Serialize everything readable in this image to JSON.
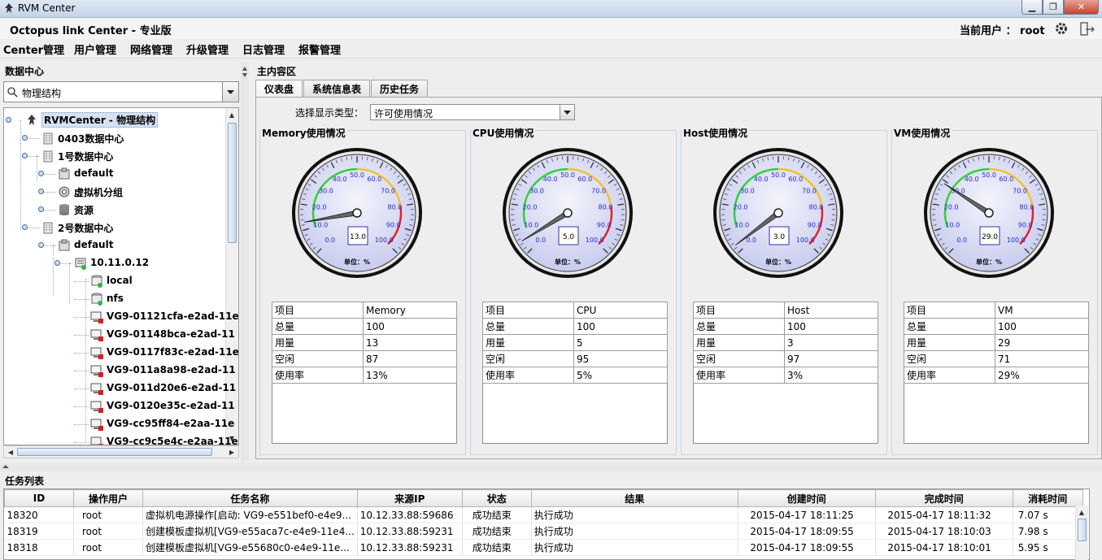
{
  "window": {
    "title": "RVM Center"
  },
  "header": {
    "app_name": "Octopus link Center - 专业版",
    "current_user_label": "当前用户 ： root"
  },
  "menu": [
    "Center管理",
    "用户管理",
    "网络管理",
    "升级管理",
    "日志管理",
    "报警管理"
  ],
  "left": {
    "title": "数据中心",
    "search_value": "物理结构",
    "tree": [
      {
        "label": "RVMCenter - 物理结构",
        "icon": "octopus-icon",
        "level": 0,
        "selected": true
      },
      {
        "label": "0403数据中心",
        "icon": "building-icon",
        "level": 1
      },
      {
        "label": "1号数据中心",
        "icon": "building-icon",
        "level": 1
      },
      {
        "label": "default",
        "icon": "cluster-icon",
        "level": 2
      },
      {
        "label": "虚拟机分组",
        "icon": "vm-group-icon",
        "level": 2
      },
      {
        "label": "资源",
        "icon": "database-icon",
        "level": 2
      },
      {
        "label": "2号数据中心",
        "icon": "building-icon",
        "level": 1
      },
      {
        "label": "default",
        "icon": "cluster-icon",
        "level": 2
      },
      {
        "label": "10.11.0.12",
        "icon": "host-icon",
        "level": 3
      },
      {
        "label": "local",
        "icon": "storage-icon",
        "level": 4
      },
      {
        "label": "nfs",
        "icon": "storage-icon",
        "level": 4
      },
      {
        "label": "VG9-01121cfa-e2ad-11e",
        "icon": "vm-icon",
        "level": 4
      },
      {
        "label": "VG9-01148bca-e2ad-11",
        "icon": "vm-icon",
        "level": 4
      },
      {
        "label": "VG9-0117f83c-e2ad-11e",
        "icon": "vm-icon",
        "level": 4
      },
      {
        "label": "VG9-011a8a98-e2ad-11",
        "icon": "vm-icon",
        "level": 4
      },
      {
        "label": "VG9-011d20e6-e2ad-11",
        "icon": "vm-icon",
        "level": 4
      },
      {
        "label": "VG9-0120e35c-e2ad-11",
        "icon": "vm-icon",
        "level": 4
      },
      {
        "label": "VG9-cc95ff84-e2aa-11e",
        "icon": "vm-icon",
        "level": 4
      },
      {
        "label": "VG9-cc9c5e4c-e2aa-11e",
        "icon": "vm-icon",
        "level": 4
      }
    ]
  },
  "main": {
    "title": "主内容区",
    "tabs": [
      "仪表盘",
      "系统信息表",
      "历史任务"
    ],
    "active_tab": 0,
    "filter_label": "选择显示类型：",
    "filter_value": "许可使用情况",
    "gauge_unit": "单位：%",
    "gauge_ticks": [
      "0.0",
      "10.0",
      "20.0",
      "30.0",
      "40.0",
      "50.0",
      "60.0",
      "70.0",
      "80.0",
      "90.0",
      "100.0"
    ],
    "gauges": [
      {
        "title": "Memory使用情况",
        "value": 13,
        "display": "13.0",
        "rows": [
          [
            "项目",
            "Memory"
          ],
          [
            "总量",
            "100"
          ],
          [
            "用量",
            "13"
          ],
          [
            "空闲",
            "87"
          ],
          [
            "使用率",
            "13%"
          ]
        ]
      },
      {
        "title": "CPU使用情况",
        "value": 5,
        "display": "5.0",
        "rows": [
          [
            "项目",
            "CPU"
          ],
          [
            "总量",
            "100"
          ],
          [
            "用量",
            "5"
          ],
          [
            "空闲",
            "95"
          ],
          [
            "使用率",
            "5%"
          ]
        ]
      },
      {
        "title": "Host使用情况",
        "value": 3,
        "display": "3.0",
        "rows": [
          [
            "项目",
            "Host"
          ],
          [
            "总量",
            "100"
          ],
          [
            "用量",
            "3"
          ],
          [
            "空闲",
            "97"
          ],
          [
            "使用率",
            "3%"
          ]
        ]
      },
      {
        "title": "VM使用情况",
        "value": 29,
        "display": "29.0",
        "rows": [
          [
            "项目",
            "VM"
          ],
          [
            "总量",
            "100"
          ],
          [
            "用量",
            "29"
          ],
          [
            "空闲",
            "71"
          ],
          [
            "使用率",
            "29%"
          ]
        ]
      }
    ]
  },
  "tasks": {
    "title": "任务列表",
    "columns": [
      "ID",
      "操作用户",
      "任务名称",
      "来源IP",
      "状态",
      "结果",
      "创建时间",
      "完成时间",
      "消耗时间"
    ],
    "rows": [
      [
        "18320",
        "root",
        "虚拟机电源操作[启动: VG9-e551bef0-e4e9...",
        "10.12.33.88:59686",
        "成功结束",
        "执行成功",
        "2015-04-17 18:11:25",
        "2015-04-17 18:11:32",
        "7.07 s"
      ],
      [
        "18319",
        "root",
        "创建模板虚拟机[VG9-e55aca7c-e4e9-11e4...",
        "10.12.33.88:59231",
        "成功结束",
        "执行成功",
        "2015-04-17 18:09:55",
        "2015-04-17 18:10:03",
        "7.98 s"
      ],
      [
        "18318",
        "root",
        "创建模板虚拟机[VG9-e55680c0-e4e9-11e...",
        "10.12.33.88:59231",
        "成功结束",
        "执行成功",
        "2015-04-17 18:09:55",
        "2015-04-17 18:10:01",
        "5.95 s"
      ]
    ]
  },
  "colors": {
    "gauge_face": "#c8ccee",
    "green_zone": "#2fd13a",
    "yellow_zone": "#f2c12e",
    "red_zone": "#e0242b",
    "selection": "#d6e2f2"
  }
}
